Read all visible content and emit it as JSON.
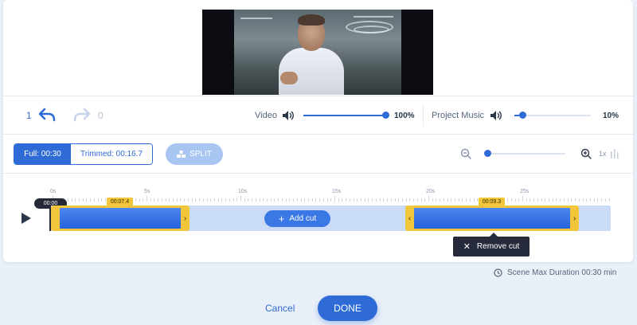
{
  "history": {
    "undo_count": "1",
    "redo_count": "0"
  },
  "audio": {
    "video_label": "Video",
    "video_volume": "100%",
    "video_level": 1.0,
    "music_label": "Project Music",
    "music_volume": "10%",
    "music_level": 0.1
  },
  "durations": {
    "full_label": "Full: 00:30",
    "trimmed_label": "Trimmed: 00:16.7"
  },
  "split_label": "SPLIT",
  "zoom": {
    "level_label": "1x"
  },
  "timeline": {
    "ruler_labels": [
      "0s",
      "5s",
      "10s",
      "15s",
      "20s",
      "25s"
    ],
    "playhead_time": "00:00",
    "clips": [
      {
        "duration_label": "00:07.4"
      },
      {
        "duration_label": "00:09.3"
      }
    ],
    "add_cut_label": "Add cut",
    "remove_cut_label": "Remove cut"
  },
  "footer": {
    "scene_max_duration": "Scene Max Duration 00:30 min",
    "cancel_label": "Cancel",
    "done_label": "DONE"
  },
  "colors": {
    "accent": "#2f6bd6",
    "clip_border": "#f2c63b",
    "track": "#c9dbf7"
  }
}
